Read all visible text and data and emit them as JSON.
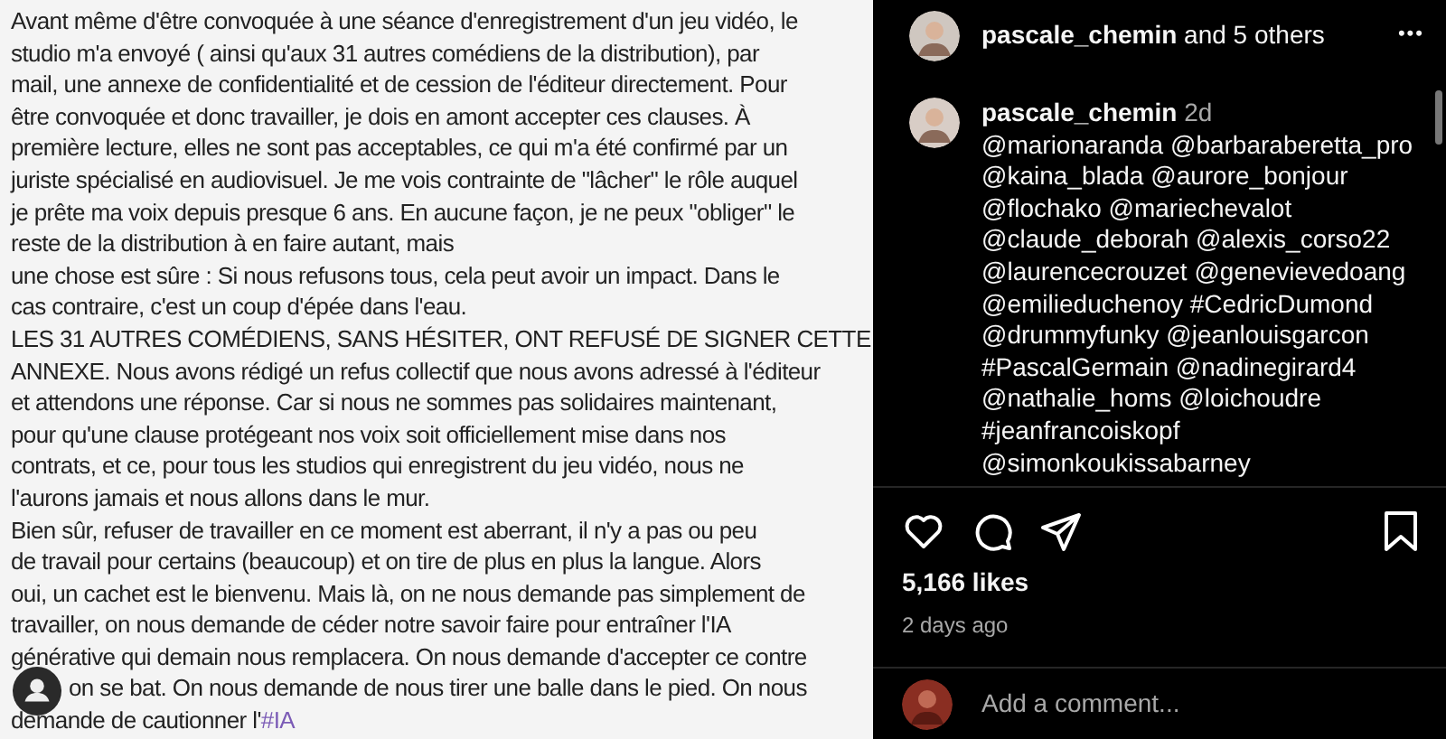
{
  "post_image": {
    "paragraphs": [
      {
        "lines": [
          "Avant même d'être convoquée à une séance d'enregistrement d'un jeu vidéo, le",
          "studio m'a envoyé ( ainsi qu'aux 31 autres comédiens de la distribution), par",
          "mail, une annexe de confidentialité et de cession de l'éditeur directement. Pour",
          "être convoquée et donc travailler, je dois en amont accepter ces clauses. À",
          "première lecture, elles ne sont pas acceptables, ce qui m'a été confirmé par un",
          "juriste spécialisé en audiovisuel. Je me vois contrainte de \"lâcher\" le rôle auquel",
          "je prête ma voix depuis presque 6 ans. En aucune façon, je ne peux \"obliger\" le",
          "reste de la distribution à en faire autant, mais"
        ]
      },
      {
        "lines": [
          "une chose est sûre : Si nous refusons tous, cela peut avoir un impact. Dans le",
          "cas contraire, c'est un coup d'épée dans l'eau."
        ]
      },
      {
        "lines": [
          "LES 31 AUTRES COMÉDIENS, SANS HÉSITER, ONT REFUSÉ DE SIGNER CETTE",
          "ANNEXE. Nous avons rédigé un refus collectif que nous avons adressé à l'éditeur",
          "et attendons une réponse. Car si nous ne sommes pas solidaires maintenant,",
          "pour qu'une clause protégeant nos voix soit officiellement mise dans nos",
          "contrats, et ce, pour tous les studios qui enregistrent du jeu vidéo, nous ne",
          "l'aurons jamais et nous allons dans le mur."
        ]
      },
      {
        "lines": [
          "Bien sûr, refuser de travailler en ce moment est aberrant, il n'y a pas ou peu",
          "de travail pour certains (beaucoup) et on tire de plus en plus la langue. Alors",
          "oui, un cachet est le bienvenu. Mais là, on ne nous demande pas simplement de",
          "travailler, on nous demande de céder notre savoir faire pour entraîner l'IA",
          "générative qui demain nous remplacera. On nous demande d'accepter ce contre"
        ],
        "line_under_avatar": "on se bat. On nous demande de nous tirer une balle dans le pied. On nous",
        "last_line": "demande de cautionner l'",
        "hashtag": "#IA"
      }
    ]
  },
  "post_header": {
    "username": "pascale_chemin",
    "rest": "and 5 others",
    "more": "•••"
  },
  "comment": {
    "username": "pascale_chemin",
    "time": "2d",
    "lines": [
      "@marionaranda @barbaraberetta_pro",
      "@kaina_blada @aurore_bonjour",
      "@flochako @mariechevalot",
      "@claude_deborah @alexis_corso22",
      "@laurencecrouzet @genevievedoang",
      "@emilieduchenoy #CedricDumond",
      "@drummyfunky @jeanlouisgarcon",
      "#PascalGermain @nadinegirard4",
      "@nathalie_homs @loichoudre",
      "#jeanfrancoiskopf",
      "@simonkoukissabarney"
    ]
  },
  "actions": {
    "liked": false,
    "saved": false
  },
  "likes": "5,166 likes",
  "date": "2 days ago",
  "comment_field": {
    "placeholder": "Add a comment..."
  }
}
